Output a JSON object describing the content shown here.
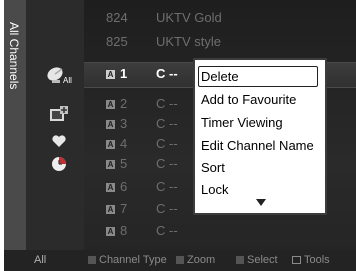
{
  "sidebar": {
    "title": "All Channels"
  },
  "channels": [
    {
      "num": "824",
      "name": "UKTV Gold",
      "badge": ""
    },
    {
      "num": "825",
      "name": "UKTV style",
      "badge": ""
    },
    {
      "num": "1",
      "name": "C --",
      "badge": "A"
    },
    {
      "num": "2",
      "name": "C --",
      "badge": "A"
    },
    {
      "num": "3",
      "name": "C --",
      "badge": "A"
    },
    {
      "num": "4",
      "name": "C --",
      "badge": "A"
    },
    {
      "num": "5",
      "name": "C --",
      "badge": "A"
    },
    {
      "num": "6",
      "name": "C --",
      "badge": "A"
    },
    {
      "num": "7",
      "name": "C --",
      "badge": "A"
    },
    {
      "num": "8",
      "name": "C --",
      "badge": "A"
    }
  ],
  "icons": {
    "all": "All",
    "list": [
      "add-channel-icon",
      "favourite-heart-icon",
      "timer-clock-icon"
    ]
  },
  "menu": {
    "items": [
      "Delete",
      "Add to Favourite",
      "Timer Viewing",
      "Edit Channel Name",
      "Sort",
      "Lock"
    ],
    "selected": "Delete"
  },
  "footer": {
    "all": "All",
    "channel_type": "Channel Type",
    "zoom": "Zoom",
    "select": "Select",
    "tools": "Tools",
    "colors": {
      "red": "#b93a3a",
      "green": "#3a8a3a",
      "yellow": "#c8b83a",
      "blue": "#3a5ab9"
    }
  },
  "colors": {
    "panel": "#1f1f1f",
    "menu_bg": "#ffffff"
  }
}
